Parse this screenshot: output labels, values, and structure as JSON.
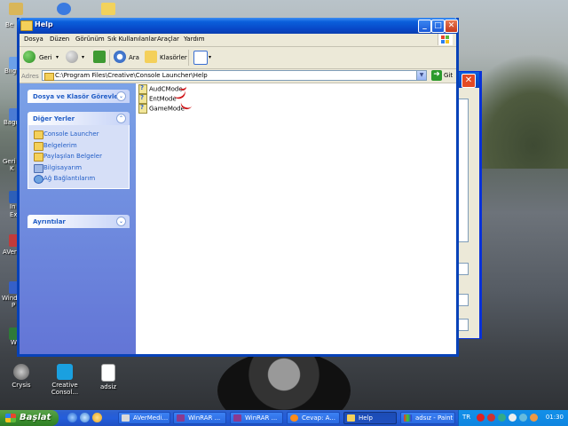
{
  "window": {
    "title": "Help",
    "menus": [
      "Dosya",
      "Düzen",
      "Görünüm",
      "Sık Kullanılanlar",
      "Araçlar",
      "Yardım"
    ],
    "toolbar": {
      "back": "Geri",
      "search": "Ara",
      "folders": "Klasörler"
    },
    "address": {
      "label": "Adres",
      "path": "C:\\Program Files\\Creative\\Console Launcher\\Help",
      "go": "Git"
    }
  },
  "sidebar": {
    "tasks_title": "Dosya ve Klasör Görevleri",
    "places_title": "Diğer Yerler",
    "places": [
      {
        "label": "Console Launcher",
        "icon": "folder-icon"
      },
      {
        "label": "Belgelerim",
        "icon": "documents-icon"
      },
      {
        "label": "Paylaşılan Belgeler",
        "icon": "folder-icon"
      },
      {
        "label": "Bilgisayarım",
        "icon": "computer-icon"
      },
      {
        "label": "Ağ Bağlantılarım",
        "icon": "network-icon"
      }
    ],
    "details_title": "Ayrıntılar"
  },
  "files": [
    {
      "name": "AudCMode",
      "icon": "help-file-icon"
    },
    {
      "name": "EntMode",
      "icon": "help-file-icon"
    },
    {
      "name": "GameMode",
      "icon": "help-file-icon"
    }
  ],
  "desktop": {
    "icons": [
      {
        "label": "Crysis",
        "icon": "crysis-icon"
      },
      {
        "label": "Creative Consol...",
        "icon": "creative-console-icon"
      },
      {
        "label": "adsiz",
        "icon": "document-icon"
      }
    ],
    "fragments": [
      "Be",
      "Bilg",
      "Bağl",
      "Geri D",
      "K",
      "In",
      "Ex",
      "AVer",
      "Windo",
      "P",
      "W"
    ]
  },
  "taskbar": {
    "start": "Başlat",
    "buttons": [
      {
        "label": "AVerMedi...",
        "icon": "avermedia-icon"
      },
      {
        "label": "WinRAR ...",
        "icon": "winrar-icon"
      },
      {
        "label": "WinRAR ...",
        "icon": "winrar-icon"
      },
      {
        "label": "Cevap: A...",
        "icon": "browser-icon"
      },
      {
        "label": "Help",
        "icon": "folder-icon"
      },
      {
        "label": "adsız - Paint",
        "icon": "paint-icon"
      }
    ],
    "language": "TR",
    "clock": "01:30"
  },
  "colors": {
    "titlebar": "#0a5fdb",
    "sidebar": "#6f8ee0",
    "start": "#3a8f2e",
    "taskbar": "#245edb",
    "annotation": "#d0161a"
  }
}
